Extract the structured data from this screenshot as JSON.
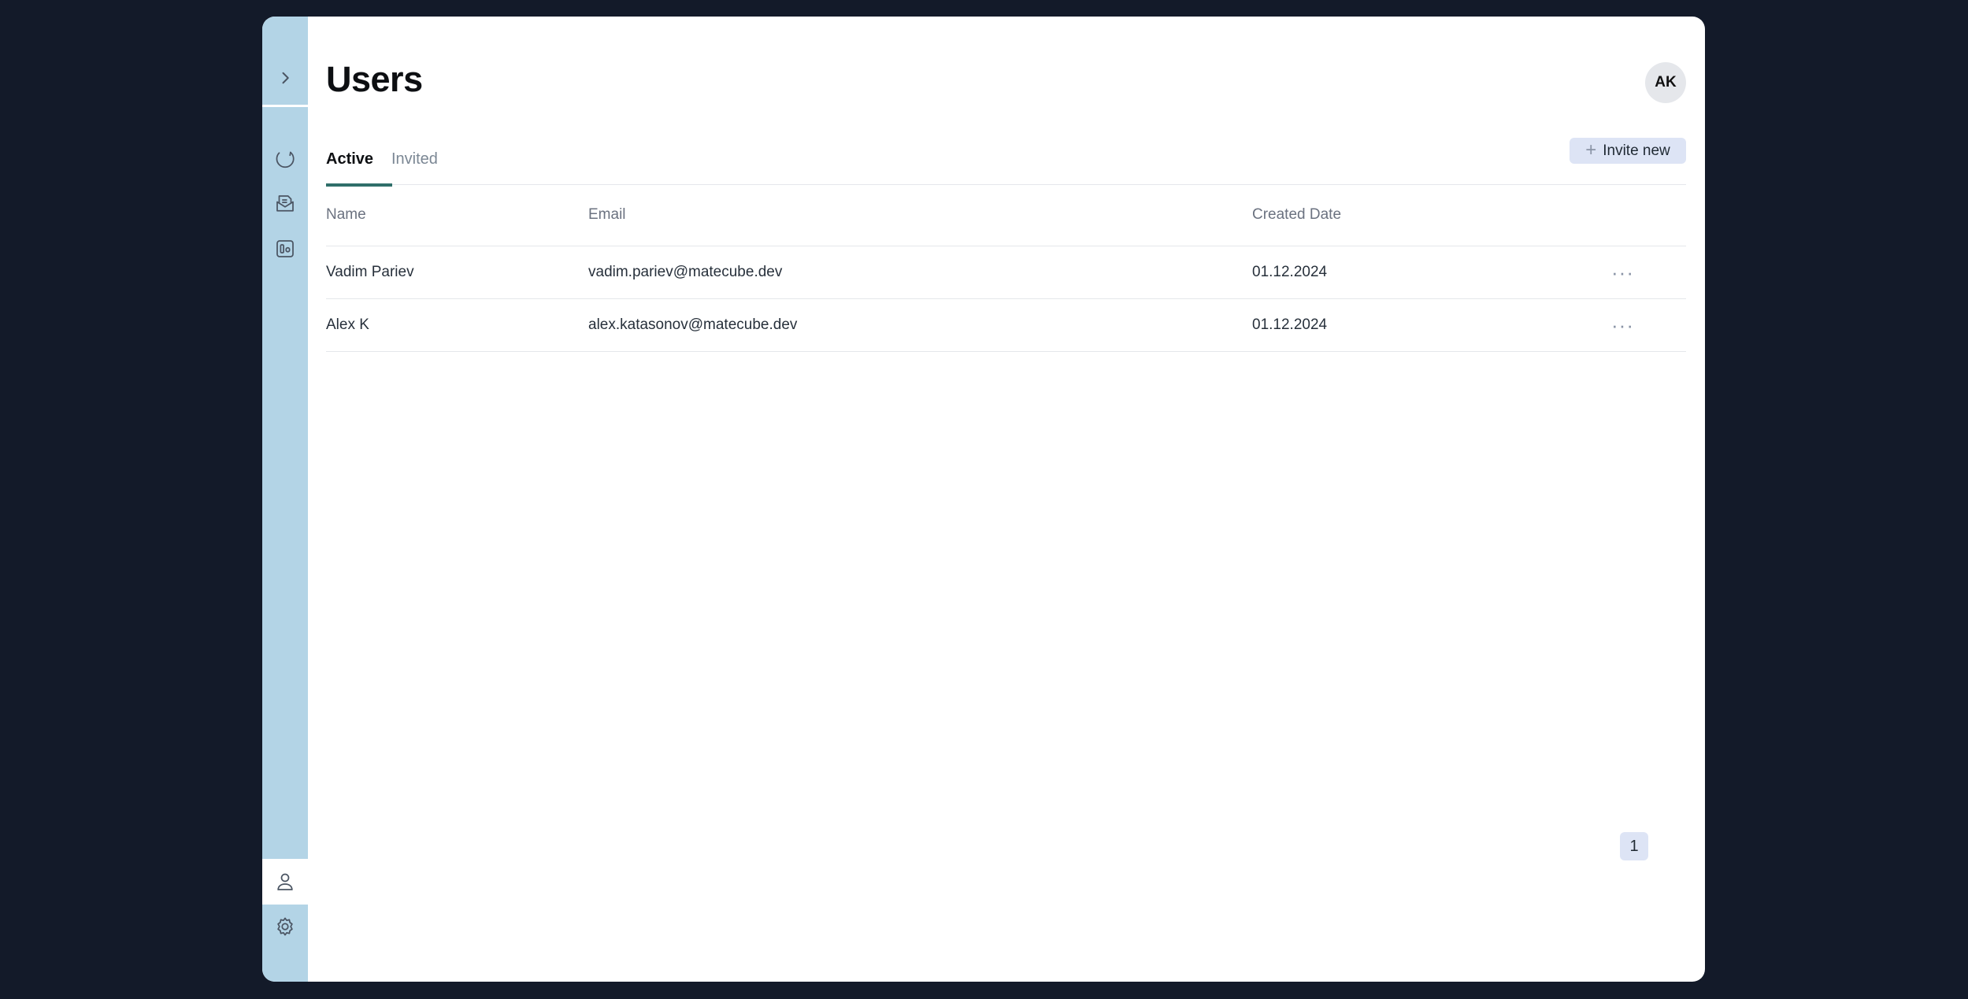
{
  "page": {
    "title": "Users"
  },
  "user": {
    "initials": "AK"
  },
  "tabs": [
    {
      "label": "Active",
      "active": true
    },
    {
      "label": "Invited",
      "active": false
    }
  ],
  "toolbar": {
    "invite_label": "Invite new"
  },
  "table": {
    "columns": [
      "Name",
      "Email",
      "Created Date"
    ],
    "rows": [
      {
        "name": "Vadim Pariev",
        "email": "vadim.pariev@matecube.dev",
        "created": "01.12.2024"
      },
      {
        "name": "Alex K",
        "email": "alex.katasonov@matecube.dev",
        "created": "01.12.2024"
      }
    ]
  },
  "pagination": {
    "current_page": "1"
  },
  "sidebar": {
    "items": [
      {
        "icon": "chevron-right-icon"
      },
      {
        "icon": "sync-icon"
      },
      {
        "icon": "inbox-icon"
      },
      {
        "icon": "board-icon"
      },
      {
        "icon": "user-icon",
        "active": true
      },
      {
        "icon": "gear-icon"
      }
    ]
  },
  "colors": {
    "background": "#131a29",
    "sidebar": "#b3d4e6",
    "tab_underline": "#2f6f6a",
    "button_bg": "#dde4f5"
  }
}
